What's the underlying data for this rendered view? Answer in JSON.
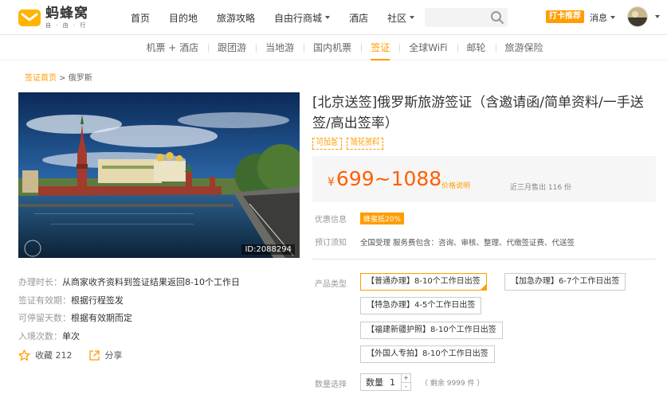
{
  "header": {
    "logo_text": "蚂蜂窝",
    "logo_sub": "自 · 由 · 行",
    "nav": [
      {
        "label": "首页",
        "dropdown": false
      },
      {
        "label": "目的地",
        "dropdown": false
      },
      {
        "label": "旅游攻略",
        "dropdown": false
      },
      {
        "label": "自由行商城",
        "dropdown": true
      },
      {
        "label": "酒店",
        "dropdown": false
      },
      {
        "label": "社区",
        "dropdown": true
      }
    ],
    "search_placeholder": "",
    "punch_label": "打卡推荐",
    "messages_label": "消息"
  },
  "subnav": {
    "items": [
      "机票 + 酒店",
      "跟团游",
      "当地游",
      "国内机票",
      "签证",
      "全球WiFi",
      "邮轮",
      "旅游保险"
    ],
    "active_index": 4
  },
  "breadcrumb": {
    "home": "签证首页",
    "separator": " > ",
    "current": "俄罗斯"
  },
  "hero": {
    "image_id": "ID:2088294"
  },
  "info": [
    {
      "label": "办理时长：",
      "value": "从商家收齐资料到签证结果返回8-10个工作日"
    },
    {
      "label": "签证有效期：",
      "value": "根据行程签发"
    },
    {
      "label": "可停留天数：",
      "value": "根据有效期而定"
    },
    {
      "label": "入境次数：",
      "value": "单次"
    }
  ],
  "actions": {
    "favorite_label": "收藏",
    "favorite_count": "212",
    "share_label": "分享"
  },
  "product": {
    "title": "[北京送签]俄罗斯旅游签证（含邀请函/简单资料/一手送签/高出签率）",
    "tags": [
      "可加急",
      "简化资料"
    ],
    "price_currency": "¥",
    "price_range": "699~1088",
    "price_note": "价格说明",
    "sold": "近三月售出 116 份",
    "offer_label": "优惠信息",
    "offer_badge": "蜂蜜抵20%",
    "notice_label": "预订须知",
    "notice_text": "全国受理 服务费包含：咨询、审核、整理、代缴签证费、代送签",
    "type_label": "产品类型",
    "types": [
      "【普通办理】8-10个工作日出签",
      "【加急办理】6-7个工作日出签",
      "【特急办理】4-5个工作日出签",
      "【福建新疆护照】8-10个工作日出签",
      "【外国人专拍】8-10个工作日出签"
    ],
    "selected_type": 0,
    "qty_label": "数量选择",
    "qty_word": "数量",
    "qty_value": "1",
    "stock": "（ 剩余 9999 件 ）"
  },
  "colors": {
    "accent": "#ff9d00",
    "price": "#ff6000"
  }
}
